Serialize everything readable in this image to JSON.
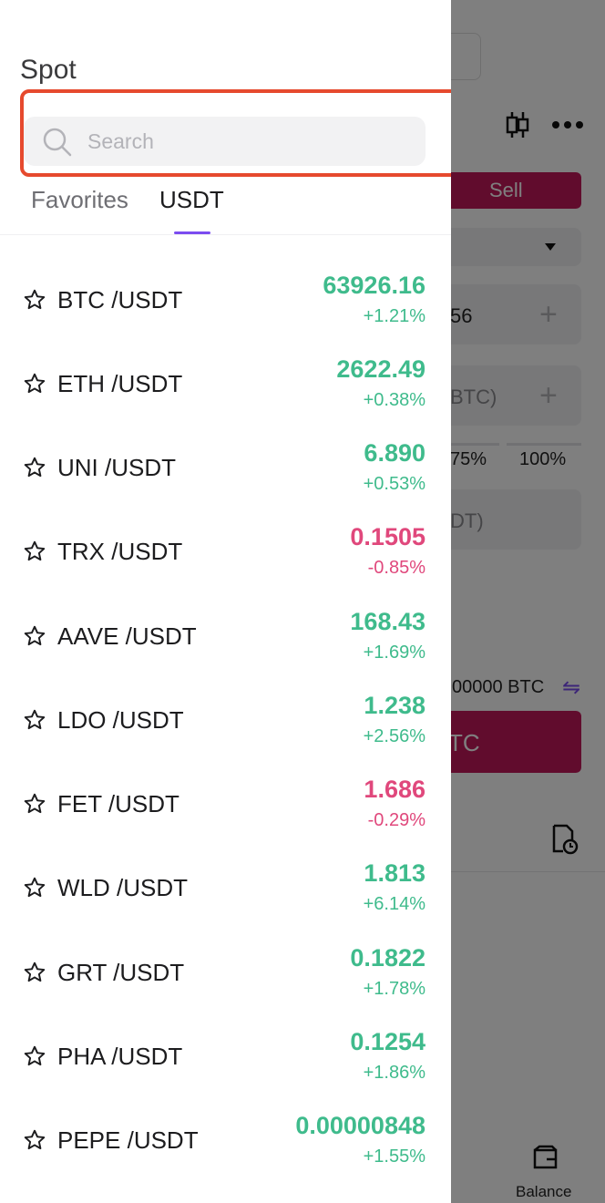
{
  "drawer": {
    "title": "Spot",
    "search": {
      "placeholder": "Search",
      "value": ""
    },
    "tabs": [
      {
        "label": "Favorites",
        "active": false
      },
      {
        "label": "USDT",
        "active": true
      }
    ],
    "pairs": [
      {
        "symbol": "BTC /USDT",
        "price": "63926.16",
        "change": "+1.21%",
        "direction": "up"
      },
      {
        "symbol": "ETH /USDT",
        "price": "2622.49",
        "change": "+0.38%",
        "direction": "up"
      },
      {
        "symbol": "UNI /USDT",
        "price": "6.890",
        "change": "+0.53%",
        "direction": "up"
      },
      {
        "symbol": "TRX /USDT",
        "price": "0.1505",
        "change": "-0.85%",
        "direction": "down"
      },
      {
        "symbol": "AAVE /USDT",
        "price": "168.43",
        "change": "+1.69%",
        "direction": "up"
      },
      {
        "symbol": "LDO /USDT",
        "price": "1.238",
        "change": "+2.56%",
        "direction": "up"
      },
      {
        "symbol": "FET /USDT",
        "price": "1.686",
        "change": "-0.29%",
        "direction": "down"
      },
      {
        "symbol": "WLD /USDT",
        "price": "1.813",
        "change": "+6.14%",
        "direction": "up"
      },
      {
        "symbol": "GRT /USDT",
        "price": "0.1822",
        "change": "+1.78%",
        "direction": "up"
      },
      {
        "symbol": "PHA /USDT",
        "price": "0.1254",
        "change": "+1.86%",
        "direction": "up"
      },
      {
        "symbol": "PEPE /USDT",
        "price": "0.00000848",
        "change": "+1.55%",
        "direction": "up"
      }
    ]
  },
  "background": {
    "sell_label": "Sell",
    "price_fragment": "56",
    "amount_fragment": "BTC)",
    "pct_75": "75%",
    "pct_100": "100%",
    "total_fragment": "DT)",
    "available_fragment": "00000 BTC",
    "action_fragment": "TC",
    "balance_label": "Balance"
  },
  "colors": {
    "up": "#3fbb8c",
    "down": "#e0487c",
    "accent": "#7b4cf0",
    "highlight": "#e64a2e",
    "sell": "#c2185b"
  }
}
